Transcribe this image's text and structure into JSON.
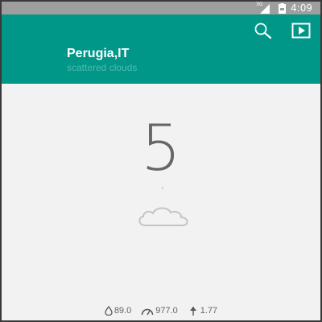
{
  "status_bar": {
    "network": "3G",
    "time": "4:09"
  },
  "header": {
    "city": "Perugia,IT",
    "description": "scattered clouds",
    "search_icon": "search-icon",
    "play_icon": "play-icon",
    "color": "#009688"
  },
  "weather": {
    "temperature": "5",
    "unit_symbol": "-",
    "condition_icon": "cloud-icon"
  },
  "stats": {
    "humidity": "89.0",
    "pressure": "977.0",
    "wind": "1.77"
  }
}
